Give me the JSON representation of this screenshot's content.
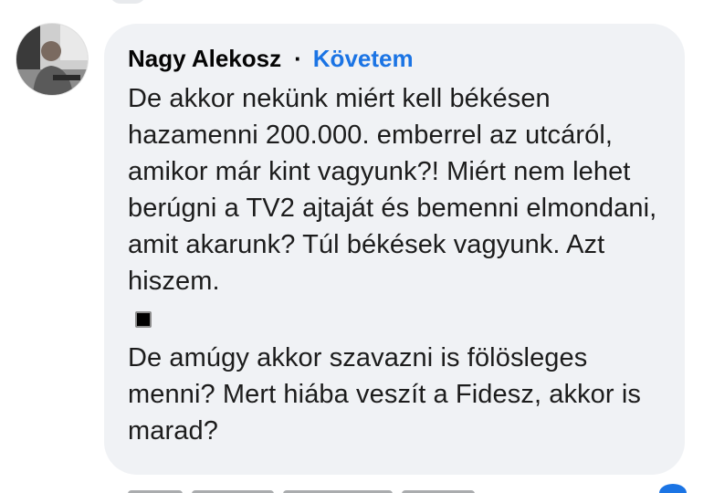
{
  "comment": {
    "author": "Nagy Alekosz",
    "separator": "·",
    "follow_label": "Követem",
    "paragraphs": [
      "De akkor nekünk miért kell békésen hazamenni 200.000. emberrel az utcáról, amikor már kint vagyunk?! Miért nem lehet berúgni a TV2 ajtaját és bemenni elmondani, amit akarunk? Túl békések vagyunk. Azt hiszem."
    ],
    "emoji": "black-square",
    "paragraphs_after": [
      "De amúgy akkor szavazni is fölösleges menni? Mert hiába veszít a Fidesz, akkor is marad?"
    ]
  },
  "colors": {
    "bubble_bg": "#f0f2f5",
    "follow_link": "#1b74e4",
    "text": "#050505"
  }
}
